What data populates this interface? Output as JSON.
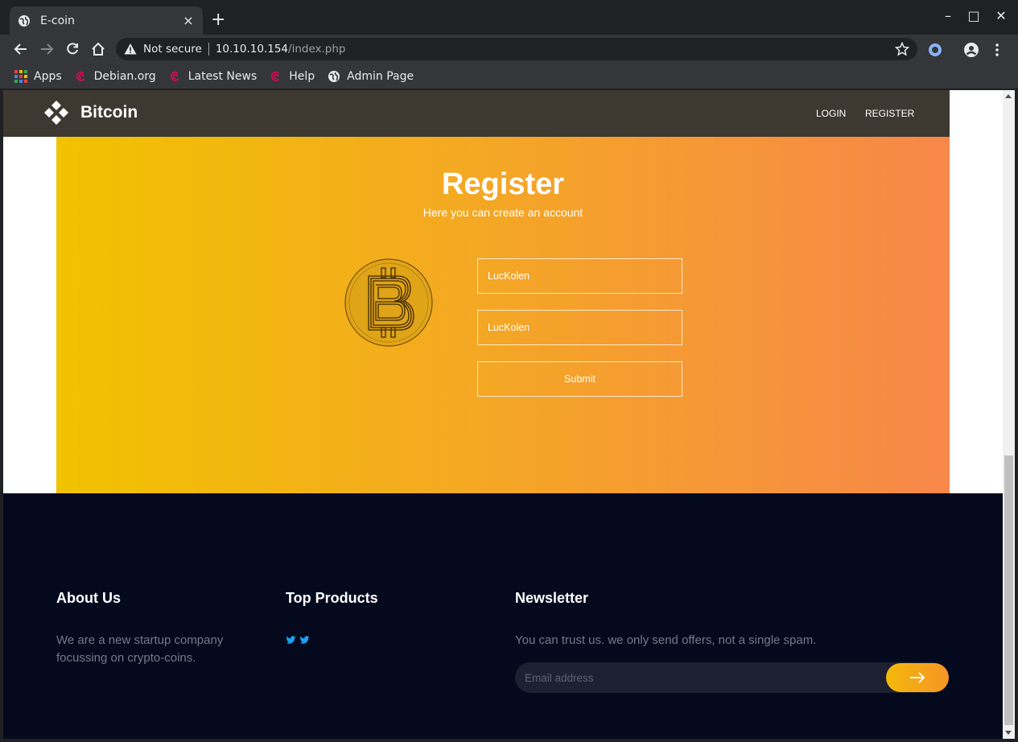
{
  "browser": {
    "tab_title": "E-coin",
    "tab_close": "×",
    "new_tab": "+",
    "window_controls": {
      "minimize": "–",
      "maximize": "□",
      "close": "✕"
    },
    "security_label": "Not secure",
    "url_host": "10.10.10.154",
    "url_path": "/index.php",
    "bookmarks": [
      {
        "label": "Apps",
        "icon": "apps-grid-icon"
      },
      {
        "label": "Debian.org",
        "icon": "debian-icon"
      },
      {
        "label": "Latest News",
        "icon": "debian-icon"
      },
      {
        "label": "Help",
        "icon": "debian-icon"
      },
      {
        "label": "Admin Page",
        "icon": "globe-icon"
      }
    ]
  },
  "site": {
    "brand": "Bitcoin",
    "nav": {
      "login": "LOGIN",
      "register": "REGISTER"
    },
    "register": {
      "title": "Register",
      "subtitle": "Here you can create an account",
      "field1_value": "LucKolen",
      "field2_value": "LucKolen",
      "submit_label": "Submit"
    },
    "footer": {
      "about_title": "About Us",
      "about_text": "We are a new startup company focussing on crypto-coins.",
      "products_title": "Top Products",
      "newsletter_title": "Newsletter",
      "newsletter_text": "You can trust us. we only send offers, not a single spam.",
      "email_placeholder": "Email address"
    }
  },
  "colors": {
    "gradient_start": "#f1c200",
    "gradient_end": "#f7874a",
    "footer_bg": "#04091e",
    "twitter": "#1da1f2"
  }
}
